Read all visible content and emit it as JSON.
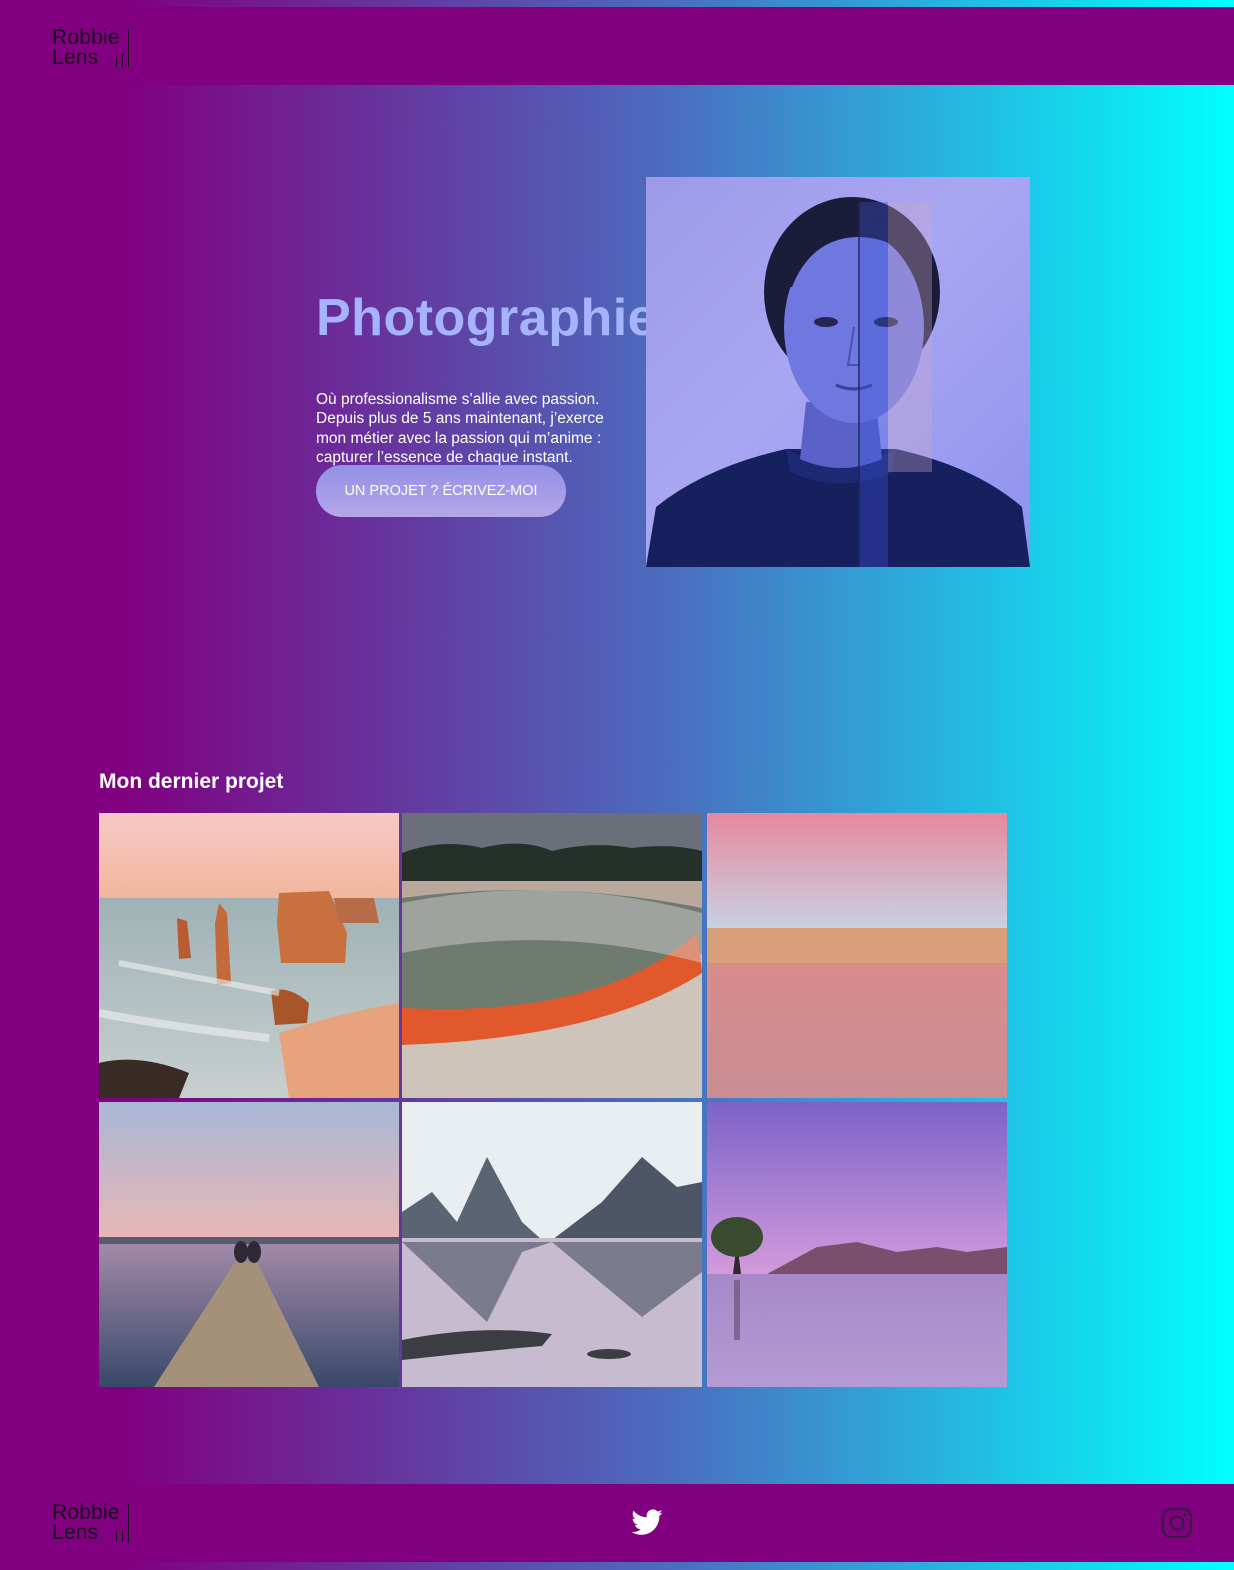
{
  "brand": {
    "line1": "Robbie",
    "line2": "Lens"
  },
  "hero": {
    "title": "Photographie",
    "description": "Où professionalisme s’allie avec passion. Depuis plus de 5 ans maintenant, j’exerce mon métier avec la passion qui m’anime : capturer l’essence de chaque instant.",
    "cta_label": "UN PROJET ? ÉCRIVEZ-MOI"
  },
  "projects": {
    "title": "Mon dernier projet",
    "photos": [
      {
        "subject": "sea-stacks-coast"
      },
      {
        "subject": "hot-spring-pool"
      },
      {
        "subject": "pink-sunset-beach"
      },
      {
        "subject": "couple-on-jetty"
      },
      {
        "subject": "mountain-lake-reflection"
      },
      {
        "subject": "lone-tree-lake"
      }
    ]
  },
  "footer": {
    "icons": [
      "twitter-icon",
      "instagram-icon"
    ]
  },
  "colors": {
    "header_bg": "#800080",
    "gradient_start": "#800080",
    "gradient_end": "#00ffff",
    "title": "#a6b4ff"
  }
}
